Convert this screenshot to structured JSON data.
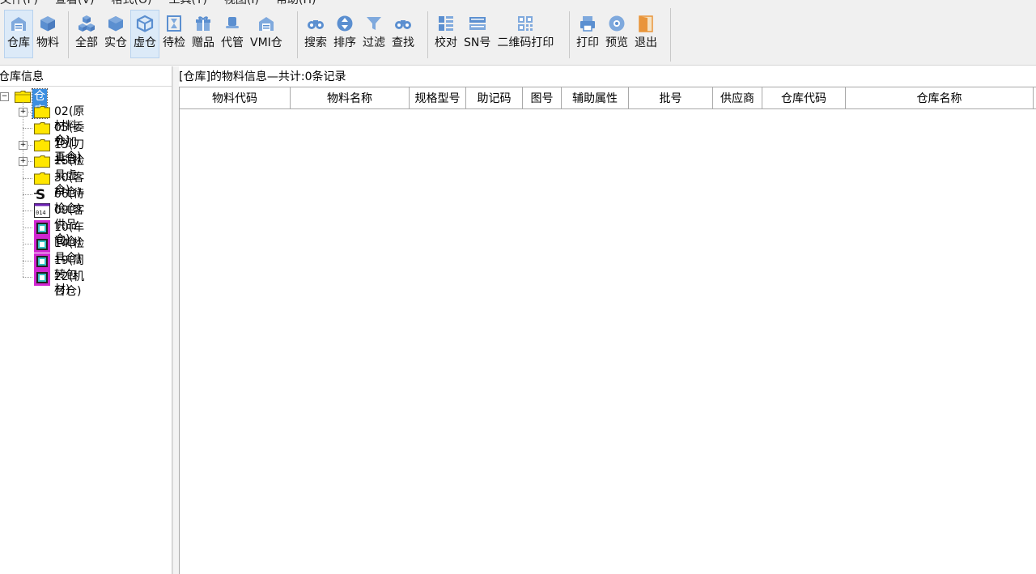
{
  "menu": [
    "文件(F)",
    "查看(V)",
    "格式(O)",
    "工具(T)",
    "视图(I)",
    "帮助(H)"
  ],
  "toolbar": {
    "groups": [
      [
        {
          "label": "仓库",
          "icon": "warehouse-icon",
          "active": true
        },
        {
          "label": "物料",
          "icon": "cube-icon",
          "active": false
        }
      ],
      [
        {
          "label": "全部",
          "icon": "cubes-icon",
          "active": false
        },
        {
          "label": "实仓",
          "icon": "cube-solid-icon",
          "active": false
        },
        {
          "label": "虚仓",
          "icon": "cube-outline-icon",
          "active": true
        },
        {
          "label": "待检",
          "icon": "hourglass-icon",
          "active": false
        },
        {
          "label": "赠品",
          "icon": "gift-icon",
          "active": false
        },
        {
          "label": "代管",
          "icon": "hat-icon",
          "active": false
        },
        {
          "label": "VMI仓",
          "icon": "warehouse-icon",
          "active": false
        }
      ],
      [
        {
          "label": "搜索",
          "icon": "binoculars-icon",
          "active": false
        },
        {
          "label": "排序",
          "icon": "sort-icon",
          "active": false
        },
        {
          "label": "过滤",
          "icon": "filter-icon",
          "active": false
        },
        {
          "label": "查找",
          "icon": "binoculars-icon",
          "active": false
        }
      ],
      [
        {
          "label": "校对",
          "icon": "check-list-icon",
          "active": false
        },
        {
          "label": "SN号",
          "icon": "sn-icon",
          "active": false
        },
        {
          "label": "二维码打印",
          "icon": "qrcode-icon",
          "active": false
        }
      ],
      [
        {
          "label": "打印",
          "icon": "printer-icon",
          "active": false
        },
        {
          "label": "预览",
          "icon": "eye-icon",
          "active": false
        },
        {
          "label": "退出",
          "icon": "exit-door-icon",
          "active": false
        }
      ]
    ]
  },
  "left_panel": {
    "title": "仓库信息",
    "tree": {
      "root": "仓库",
      "items": [
        {
          "label": "02(原材料仓)",
          "expandable": true,
          "icon": "folder-icon"
        },
        {
          "label": "05(委外加工仓)",
          "expandable": false,
          "icon": "folder-icon"
        },
        {
          "label": "13(刀具仓)",
          "expandable": true,
          "icon": "folder-icon"
        },
        {
          "label": "15(检具虚仓)",
          "expandable": true,
          "icon": "folder-icon"
        },
        {
          "label": "30(客户仓)",
          "expandable": false,
          "icon": "folder-icon"
        },
        {
          "label": "06(待检仓)",
          "expandable": false,
          "icon": "inspect-s-icon"
        },
        {
          "label": "09(客供品仓)",
          "expandable": false,
          "icon": "customer-supplied-icon"
        },
        {
          "label": "10(车间仓)",
          "expandable": false,
          "icon": "workshop-icon"
        },
        {
          "label": "14(检具仓)",
          "expandable": false,
          "icon": "workshop-icon"
        },
        {
          "label": "19(周转包材)",
          "expandable": false,
          "icon": "workshop-icon"
        },
        {
          "label": "22(机台仓)",
          "expandable": false,
          "icon": "workshop-icon"
        }
      ]
    }
  },
  "right_panel": {
    "info": "[仓库]的物料信息—共计:0条记录",
    "columns": [
      "物料代码",
      "物料名称",
      "规格型号",
      "助记码",
      "图号",
      "辅助属性",
      "批号",
      "供应商",
      "仓库代码",
      "仓库名称"
    ]
  }
}
